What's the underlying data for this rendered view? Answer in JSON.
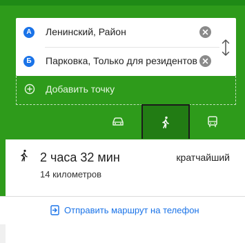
{
  "directions": {
    "origin": {
      "badge": "А",
      "text": "Ленинский, Район"
    },
    "destination": {
      "badge": "Б",
      "text": "Парковка, Только для резидентов"
    },
    "add_point_label": "Добавить точку",
    "modes": [
      {
        "name": "car",
        "icon": "car-icon",
        "selected": false
      },
      {
        "name": "walk",
        "icon": "walk-icon",
        "selected": true
      },
      {
        "name": "bus",
        "icon": "bus-icon",
        "selected": false
      }
    ]
  },
  "result": {
    "duration": "2 часа 32 мин",
    "badge": "кратчайший",
    "distance": "14 километров"
  },
  "send_to_phone_label": "Отправить маршрут на телефон",
  "colors": {
    "panel_green": "#2e9b1b",
    "selected_mode": "#227c14",
    "accent_blue": "#1a73e8"
  }
}
